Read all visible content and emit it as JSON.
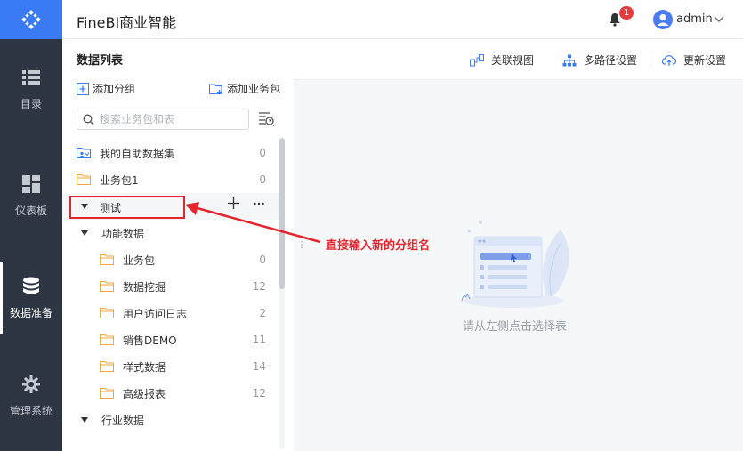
{
  "app": {
    "title": "FineBI商业智能"
  },
  "header": {
    "notification_count": "1",
    "user": "admin"
  },
  "nav": {
    "items": [
      {
        "label": "目录",
        "icon": "list-icon"
      },
      {
        "label": "仪表板",
        "icon": "dashboard-icon"
      },
      {
        "label": "数据准备",
        "icon": "database-icon",
        "active": true
      },
      {
        "label": "管理系统",
        "icon": "gear-icon"
      }
    ]
  },
  "panel": {
    "title": "数据列表",
    "add_group": "添加分组",
    "add_package": "添加业务包",
    "search_placeholder": "搜索业务包和表",
    "tree": [
      {
        "label": "我的自助数据集",
        "count": "0"
      },
      {
        "label": "业务包1",
        "count": "0"
      },
      {
        "label": "测试",
        "editing": true
      },
      {
        "label": "功能数据",
        "children": [
          {
            "label": "业务包",
            "count": "0"
          },
          {
            "label": "数据挖掘",
            "count": "12"
          },
          {
            "label": "用户访问日志",
            "count": "2"
          },
          {
            "label": "销售DEMO",
            "count": "11"
          },
          {
            "label": "样式数据",
            "count": "14"
          },
          {
            "label": "高级报表",
            "count": "12"
          }
        ]
      },
      {
        "label": "行业数据"
      }
    ]
  },
  "toolbar": {
    "relation_view": "关联视图",
    "multi_path": "多路径设置",
    "update_settings": "更新设置"
  },
  "content": {
    "empty_text": "请从左侧点击选择表"
  },
  "annotation": {
    "text": "直接输入新的分组名"
  },
  "colors": {
    "accent": "#3a7bf3",
    "nav_bg": "#2f3643",
    "annotation": "#e3262e",
    "folder": "#f2a73b"
  }
}
